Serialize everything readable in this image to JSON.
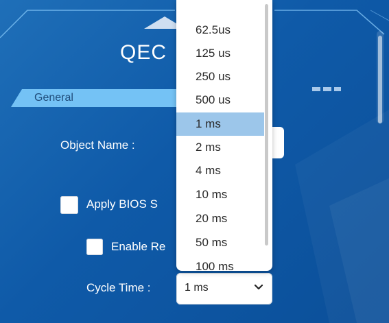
{
  "window": {
    "title": "QEC"
  },
  "section": {
    "label": "General"
  },
  "fields": {
    "object_name_label": "Object Name :",
    "apply_bios_label": "Apply BIOS S",
    "enable_re_label": "Enable Re",
    "cycle_time_label": "Cycle Time :"
  },
  "dropdown": {
    "options": [
      "62.5us",
      "125 us",
      "250 us",
      "500 us",
      "1 ms",
      "2 ms",
      "4 ms",
      "10 ms",
      "20 ms",
      "50 ms",
      "100 ms"
    ],
    "selected": "1 ms"
  },
  "cycle_time": {
    "value": "1 ms"
  },
  "icons": {
    "chevron": "chevron-down-icon",
    "checkbox": "checkbox-unchecked"
  },
  "colors": {
    "accent": "#74c2f5",
    "background": "#0f5aa8",
    "selected_option": "#9cc6ea"
  }
}
